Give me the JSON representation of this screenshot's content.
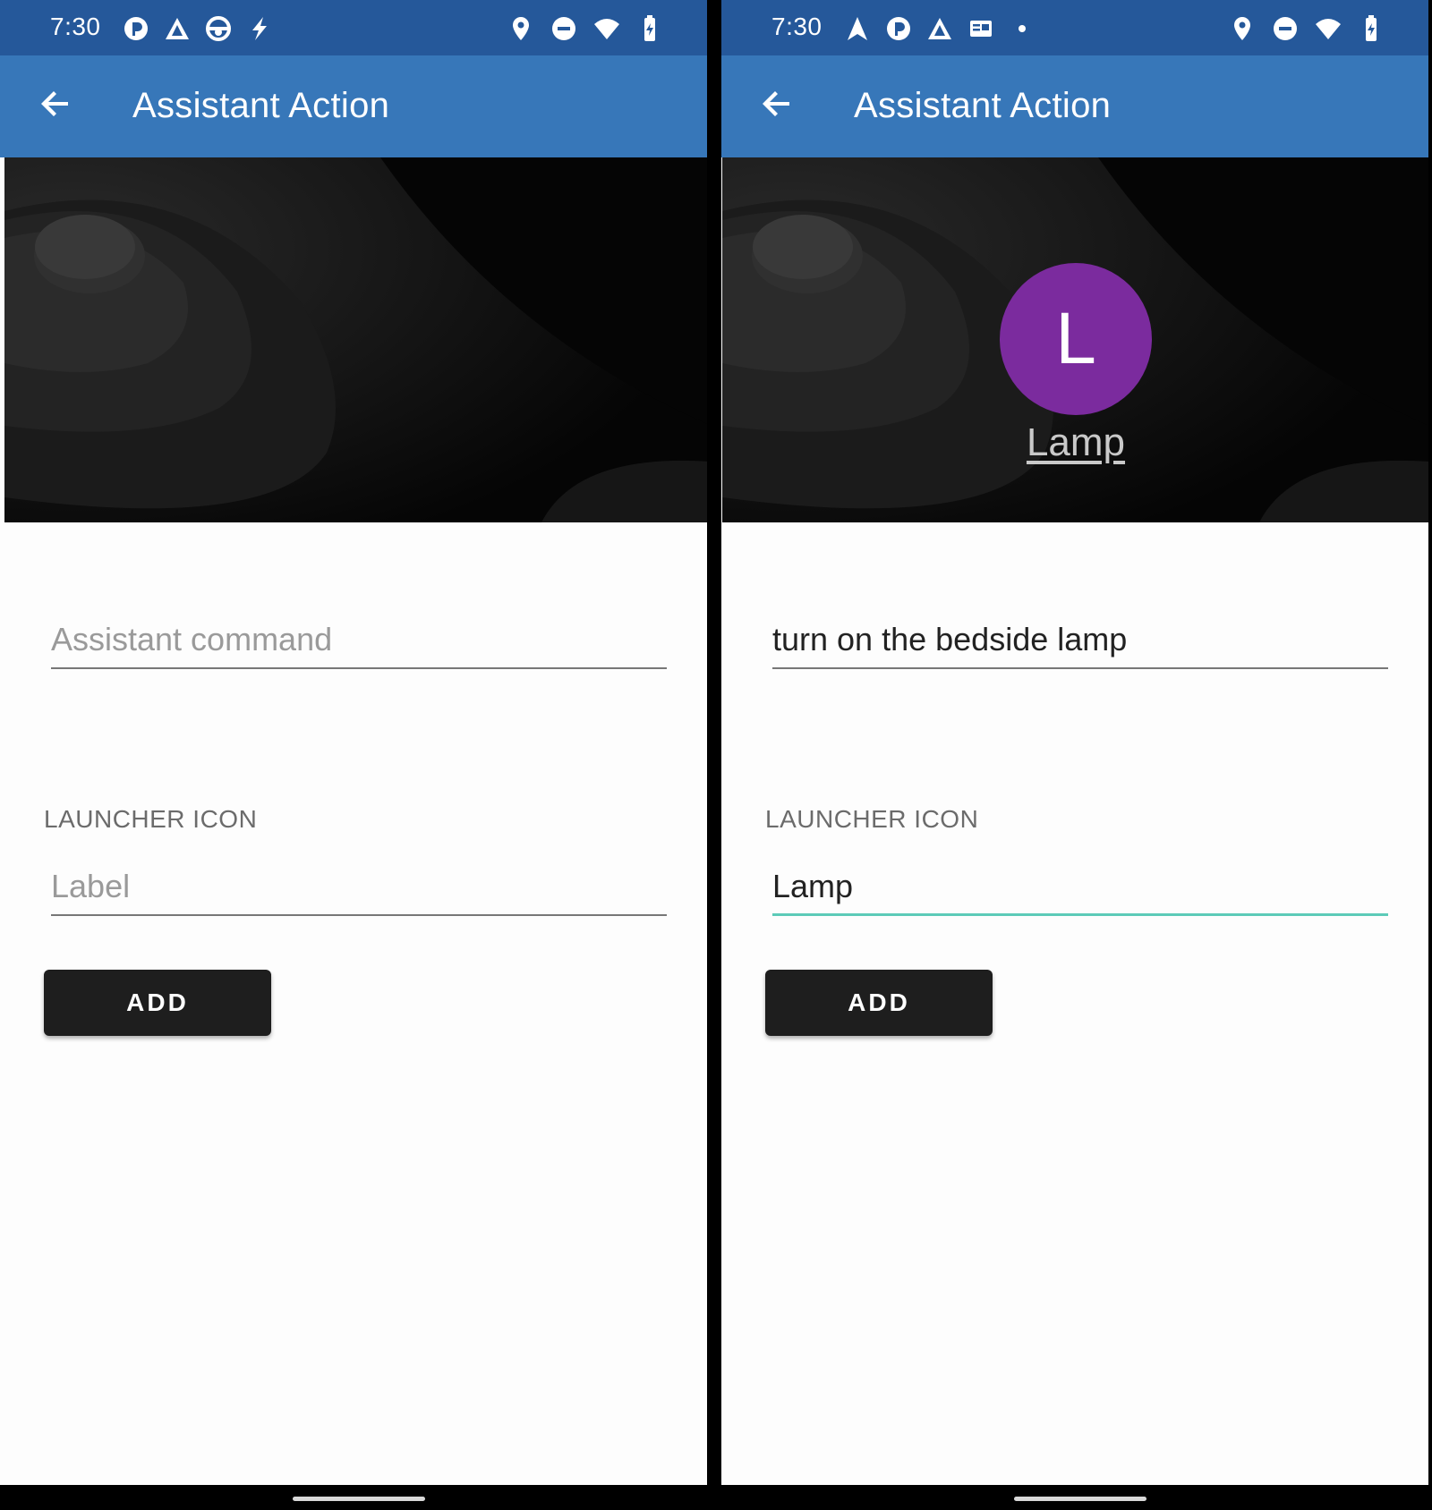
{
  "screens": [
    {
      "status_bar": {
        "time": "7:30",
        "left_icons": [
          "pocketcasts-icon",
          "arrow-app-icon",
          "steering-wheel-icon",
          "flash-icon"
        ],
        "right_icons": [
          "location-icon",
          "dnd-icon",
          "wifi-icon",
          "battery-charging-icon"
        ]
      },
      "app_bar": {
        "title": "Assistant Action",
        "back_icon": "back-arrow-icon"
      },
      "hero": {
        "avatar_letter": "",
        "avatar_label": ""
      },
      "command_field": {
        "value": "",
        "placeholder": "Assistant command"
      },
      "section_title": "LAUNCHER ICON",
      "label_field": {
        "value": "",
        "placeholder": "Label"
      },
      "add_button": "ADD"
    },
    {
      "status_bar": {
        "time": "7:30",
        "left_icons": [
          "navigation-icon",
          "pocketcasts-icon",
          "arrow-app-icon",
          "message-icon",
          "dot-icon"
        ],
        "right_icons": [
          "location-icon",
          "dnd-icon",
          "wifi-icon",
          "battery-charging-icon"
        ]
      },
      "app_bar": {
        "title": "Assistant Action",
        "back_icon": "back-arrow-icon"
      },
      "hero": {
        "avatar_letter": "L",
        "avatar_label": "Lamp"
      },
      "command_field": {
        "value": "turn on the bedside lamp",
        "placeholder": "Assistant command"
      },
      "section_title": "LAUNCHER ICON",
      "label_field": {
        "value": "Lamp",
        "placeholder": "Label"
      },
      "add_button": "ADD"
    }
  ],
  "colors": {
    "status_bar": "#25589a",
    "app_bar": "#3777b9",
    "avatar": "#7b2b9e",
    "focus_underline": "#5ccbb8",
    "button": "#1e1e1e"
  }
}
